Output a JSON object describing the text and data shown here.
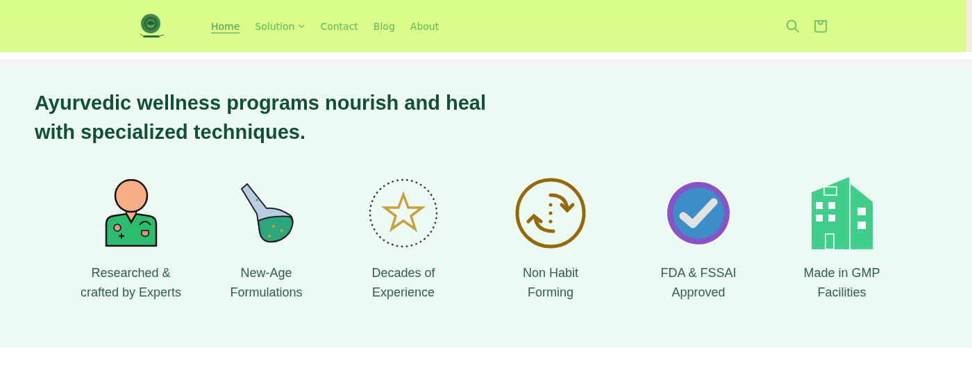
{
  "nav": [
    {
      "label": "Home",
      "selected": true,
      "dropdown": false
    },
    {
      "label": "Solution",
      "selected": false,
      "dropdown": true
    },
    {
      "label": "Contact",
      "selected": false,
      "dropdown": false
    },
    {
      "label": "Blog",
      "selected": false,
      "dropdown": false
    },
    {
      "label": "About",
      "selected": false,
      "dropdown": false
    }
  ],
  "heading": "Ayurvedic wellness programs nourish and heal with specialized techniques.",
  "features": [
    {
      "kind": "expert",
      "label": "Researched & crafted by Experts"
    },
    {
      "kind": "flask",
      "label": "New-Age Formulations"
    },
    {
      "kind": "star",
      "label": "Decades of Experience"
    },
    {
      "kind": "cycle",
      "label": "Non Habit Forming"
    },
    {
      "kind": "check",
      "label": "FDA & FSSAI Approved"
    },
    {
      "kind": "building",
      "label": "Made in GMP Facilities"
    }
  ]
}
